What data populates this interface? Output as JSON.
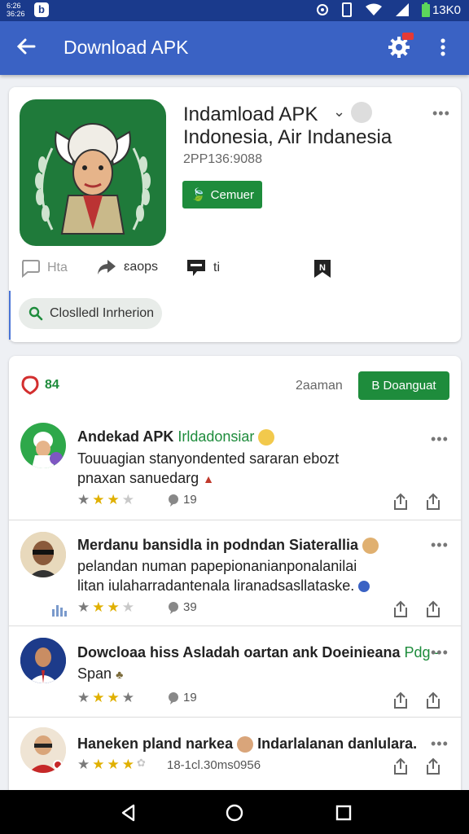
{
  "status_bar": {
    "clock": "6:26\n36:26",
    "battery": "13K0"
  },
  "app_bar": {
    "title": "Download APK"
  },
  "app": {
    "name": "Indamload APK",
    "subtitle": "Indonesia, Air Indanesia",
    "id": "2PP136:9088",
    "install_label": "Cemuer",
    "actions": [
      {
        "label": "Hta"
      },
      {
        "label": "ɛaops"
      },
      {
        "label": "ti"
      }
    ],
    "chip_label": "Closlledl Inrherion"
  },
  "summary": {
    "score": "84",
    "meta": "2aaman",
    "download_label": "B Doanguat"
  },
  "reviews": [
    {
      "title": "Andekad APK",
      "tag": "Irldadonsiar",
      "body": [
        "Touuagian stanyondented sararan ebozt",
        "pnaxan sanuedarg"
      ],
      "stars": 3,
      "comments": "19"
    },
    {
      "title": "Merdanu bansidla in podndan Siaterallia",
      "tag": "",
      "body": [
        "pelandan numan papepionanianponalanilai",
        "litan iulaharradantenala liranadsasllataske."
      ],
      "stars": 3,
      "comments": "39"
    },
    {
      "title": "Dowcloaa hiss Asladah oartan ank Doeinieana",
      "tag": "Pdg -",
      "body": [
        "Span"
      ],
      "stars": 4,
      "comments": "19"
    },
    {
      "title": "Haneken pland narkea",
      "tag": "Indarlalanan danlulara.",
      "body": [],
      "stars": 4,
      "comments": "18-1cl.30ms0956"
    }
  ]
}
